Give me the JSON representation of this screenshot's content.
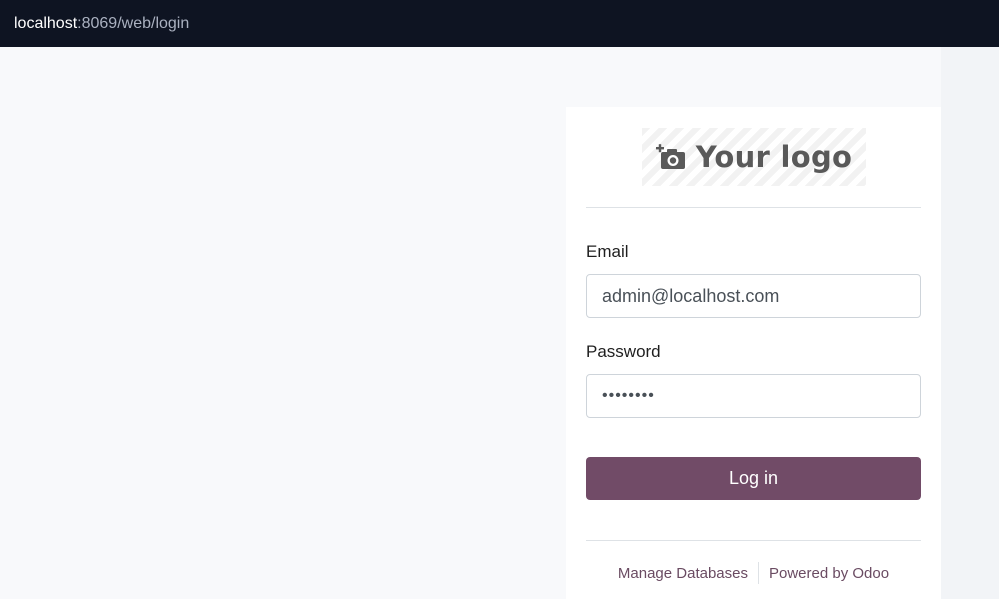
{
  "browser": {
    "url_host": "localhost",
    "url_path": ":8069/web/login"
  },
  "login": {
    "logo_text": "Your logo",
    "email_label": "Email",
    "email_value": "admin@localhost.com",
    "password_label": "Password",
    "password_masked": "••••••••",
    "submit_label": "Log in"
  },
  "footer": {
    "manage_databases": "Manage Databases",
    "powered_by": "Powered by Odoo"
  },
  "colors": {
    "accent": "#714b67",
    "topbar": "#0e1422",
    "page_bg": "#f8f9fb"
  },
  "icons": {
    "logo_icon": "camera-add-icon"
  }
}
